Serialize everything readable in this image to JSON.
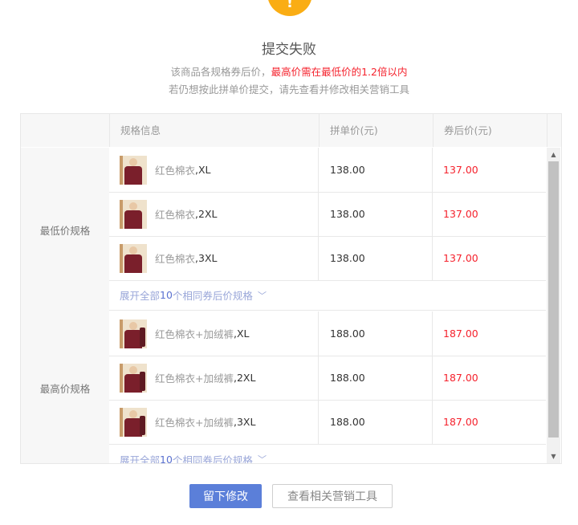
{
  "dialog": {
    "title": "提交失败",
    "message_line1_prefix": "该商品各规格券后价，",
    "message_line1_highlight": "最高价需在最低价的1.2倍以内",
    "message_line2": "若仍想按此拼单价提交，请先查看并修改相关营销工具",
    "status_icon": "warning-icon",
    "status_color": "#faad14"
  },
  "table": {
    "headers": {
      "spec": "规格信息",
      "price": "拼单价(元)",
      "coupon": "券后价(元)"
    },
    "groups": [
      {
        "label": "最低价规格",
        "rows": [
          {
            "name": "红色棉衣",
            "size": ",XL",
            "price": "138.00",
            "coupon": "137.00"
          },
          {
            "name": "红色棉衣",
            "size": ",2XL",
            "price": "138.00",
            "coupon": "137.00"
          },
          {
            "name": "红色棉衣",
            "size": ",3XL",
            "price": "138.00",
            "coupon": "137.00"
          }
        ],
        "expand": {
          "prefix": "展开全部",
          "count": "10",
          "suffix": "个相同券后价规格"
        }
      },
      {
        "label": "最高价规格",
        "rows": [
          {
            "name": "红色棉衣+加绒裤",
            "size": ",XL",
            "price": "188.00",
            "coupon": "187.00"
          },
          {
            "name": "红色棉衣+加绒裤",
            "size": ",2XL",
            "price": "188.00",
            "coupon": "187.00"
          },
          {
            "name": "红色棉衣+加绒裤",
            "size": ",3XL",
            "price": "188.00",
            "coupon": "187.00"
          }
        ],
        "expand": {
          "prefix": "展开全部",
          "count": "10",
          "suffix": "个相同券后价规格"
        }
      }
    ]
  },
  "buttons": {
    "primary": "留下修改",
    "secondary": "查看相关营销工具"
  },
  "colors": {
    "accent": "#5b7fd9",
    "price_red": "#f5222d"
  }
}
